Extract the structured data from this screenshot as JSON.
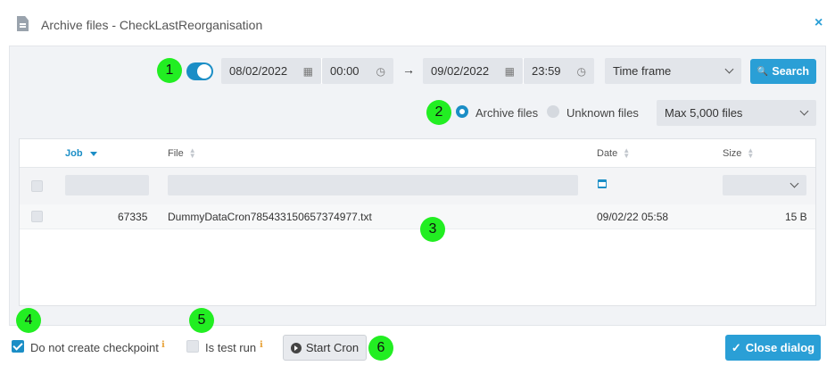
{
  "window": {
    "title": "Archive files - CheckLastReorganisation",
    "close_glyph": "×"
  },
  "filters": {
    "from_date": "08/02/2022",
    "from_time": "00:00",
    "arrow": "→",
    "to_date": "09/02/2022",
    "to_time": "23:59",
    "time_frame": "Time frame",
    "search_label": "Search",
    "search_glyph": "🔍"
  },
  "file_type": {
    "archive_label": "Archive files",
    "unknown_label": "Unknown files",
    "max_files": "Max 5,000 files"
  },
  "table": {
    "columns": [
      "Job",
      "File",
      "Date",
      "Size"
    ],
    "rows": [
      {
        "job": "67335",
        "file": "DummyDataCron785433150657374977.txt",
        "date": "09/02/22 05:58",
        "size": "15 B"
      }
    ]
  },
  "footer": {
    "no_checkpoint_label": "Do not create checkpoint",
    "test_run_label": "Is test run",
    "start_cron_label": "Start Cron",
    "close_dialog_label": "Close dialog",
    "info_glyph": "ℹ",
    "check_glyph": "✓"
  },
  "markers": [
    "1",
    "2",
    "3",
    "4",
    "5",
    "6"
  ],
  "colors": {
    "accent": "#2a9fd6",
    "toggle": "#1b8ec6",
    "marker": "#22ee22"
  }
}
